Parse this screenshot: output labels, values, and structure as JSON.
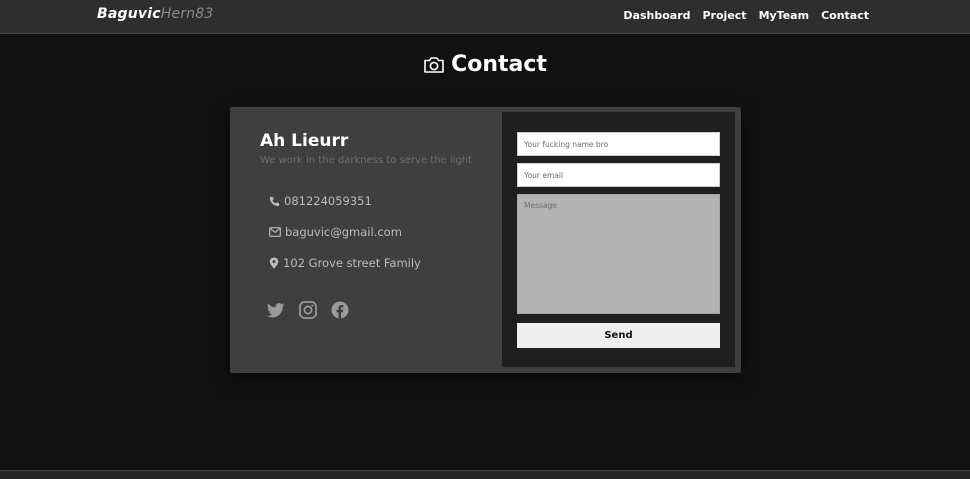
{
  "navbar": {
    "brand_primary": "Baguvic",
    "brand_secondary": "Hern83",
    "links": [
      "Dashboard",
      "Project",
      "MyTeam",
      "Contact"
    ]
  },
  "page": {
    "title": "Contact",
    "title_icon": "camera-icon"
  },
  "contact_info": {
    "name": "Ah Lieurr",
    "tagline": "We work in the darkness to serve the light",
    "phone": "081224059351",
    "email": "baguvic@gmail.com",
    "address": "102 Grove street Family",
    "socials": [
      "twitter-icon",
      "instagram-icon",
      "facebook-icon"
    ]
  },
  "form": {
    "name_placeholder": "Your fucking name bro",
    "email_placeholder": "Your email",
    "message_placeholder": "Message",
    "send_label": "Send"
  },
  "colors": {
    "background": "#111111",
    "navbar": "#2e2e2e",
    "card": "#3f3f3f",
    "form_panel": "#1f1f1f",
    "text_muted": "#6e6e6e"
  }
}
